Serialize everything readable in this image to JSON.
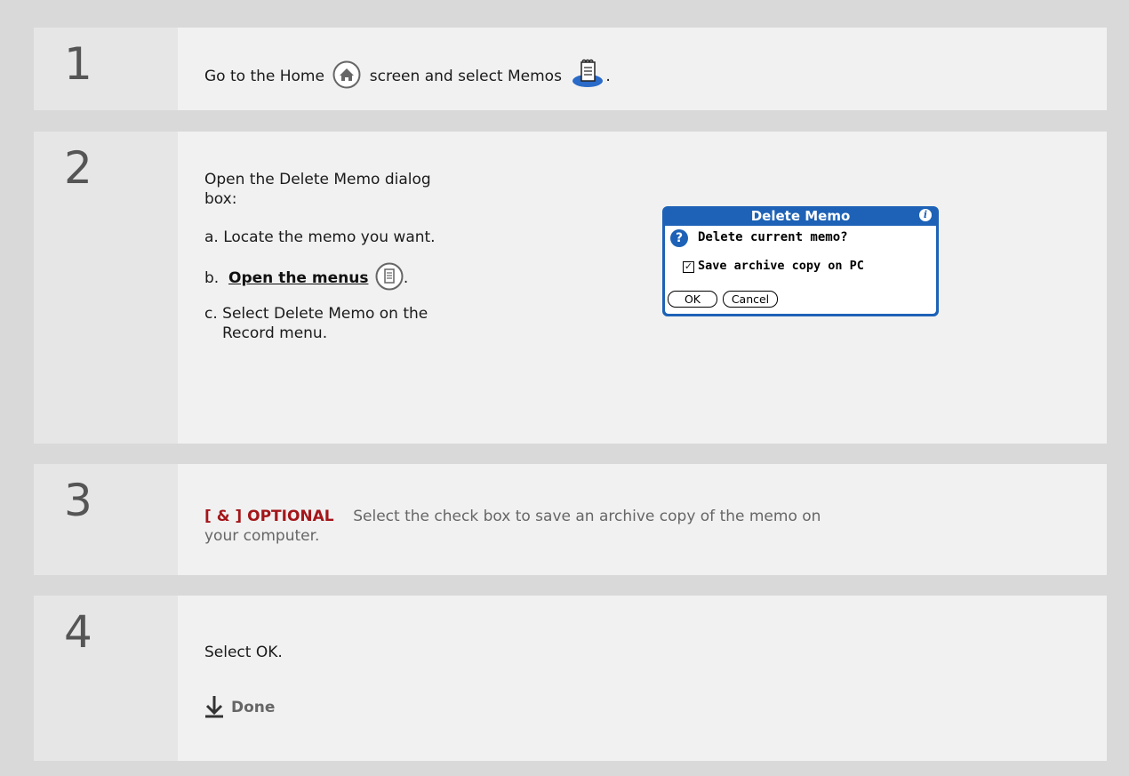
{
  "steps": [
    {
      "number": "1"
    },
    {
      "number": "2"
    },
    {
      "number": "3"
    },
    {
      "number": "4"
    }
  ],
  "step1": {
    "text_before": "Go to the Home",
    "text_middle": "screen and select Memos",
    "text_after": "."
  },
  "step2": {
    "intro_line1": "Open the Delete Memo dialog",
    "intro_line2": "box:",
    "a": "a.  Locate the memo you want.",
    "b_prefix": "b.",
    "b_link": "Open the menus",
    "b_after": ".",
    "c_line1": "c.  Select Delete Memo on the",
    "c_line2": "Record menu."
  },
  "dialog": {
    "title": "Delete Memo",
    "info": "i",
    "question_icon": "?",
    "message": "Delete current memo?",
    "checkbox_mark": "☑",
    "checkbox_label": "Save archive copy on PC",
    "checkbox_checked": true,
    "ok_label": "OK",
    "cancel_label": "Cancel"
  },
  "step3": {
    "tag": "[ & ]  OPTIONAL",
    "line1": "Select the check box to save an archive copy of the memo on",
    "line2": "your computer."
  },
  "step4": {
    "text": "Select OK.",
    "done": "Done"
  },
  "colors": {
    "background": "#d9d9d9",
    "row": "#f1f1f1",
    "optional_red": "#a3161a",
    "palm_blue": "#1d62b6"
  },
  "icons": [
    "home-icon",
    "memos-icon",
    "menu-icon",
    "down-arrow-icon"
  ]
}
